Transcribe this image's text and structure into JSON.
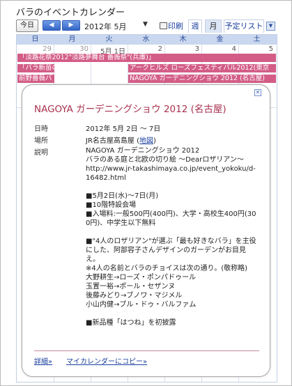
{
  "calendar_title": "バラのイベントカレンダー",
  "toolbar": {
    "today_label": "今日",
    "prev_icon": "◀",
    "next_icon": "▶",
    "month_label": "2012年 5月",
    "month_dropdown_icon": "▼",
    "print_label": "印刷",
    "view_week": "週",
    "view_month": "月",
    "view_agenda": "予定リスト",
    "agenda_dropdown_icon": "▼"
  },
  "weekdays": [
    "日",
    "月",
    "火",
    "水",
    "木",
    "金",
    "土"
  ],
  "first_week_days": [
    "29",
    "30",
    "5月 1日",
    "2",
    "3",
    "4",
    "5"
  ],
  "events": [
    {
      "label": "「淡路花祭2012\"淡路夢舞台 薔薇祭\"(兵庫)」"
    },
    {
      "label": "「バラ新苗の"
    },
    {
      "label": "アークヒルズ ローズフェスティバル2012(東京"
    },
    {
      "label": "前野薔薇バ"
    },
    {
      "label": "NAGOYA ガーデニングショウ 2012 (名古屋)"
    }
  ],
  "event_popup": {
    "close_icon": "✕",
    "title": "NAGOYA ガーデニングショウ 2012 (名古屋)",
    "date_label": "日時",
    "date_value": "2012年 5月 2日 〜 7日",
    "place_label": "場所",
    "place_value": "JR名古屋高島屋 (",
    "place_map_link": "地図",
    "place_close": ")",
    "desc_label": "説明",
    "desc_lines": [
      "NAGOYA ガーデニングショウ 2012",
      "バラのある庭と北欧の切り絵 〜Dearロザリアン〜",
      "http://www.jr-takashimaya.co.jp/event_yokoku/d-",
      "16482.html",
      "",
      "■5月2日(水)〜7日(月)",
      " ■10階特設会場",
      "■入場料:一般500円(400円)、大学・高校生400円(30",
      "0円)、中学生以下無料",
      "",
      "■\"4人のロザリアン\"が選ぶ「最も好きなバラ」を主役",
      "にした、阿部容子さんデザインのガーデンがお目見",
      "え。",
      "※4人の名前とバラのチョイスは次の通り。(敬称略)",
      "大野耕生→ローズ・ポンパドゥール",
      "玉置一裕→ポール・セザンヌ",
      "後藤みどり→ブノワ・マジメル",
      "小山内健→ブル・ドゥ・バルファム",
      "",
      "■新品種「はつね」を初披露"
    ],
    "detail_link": "詳細»",
    "copy_link": "マイカレンダーにコピー»"
  }
}
